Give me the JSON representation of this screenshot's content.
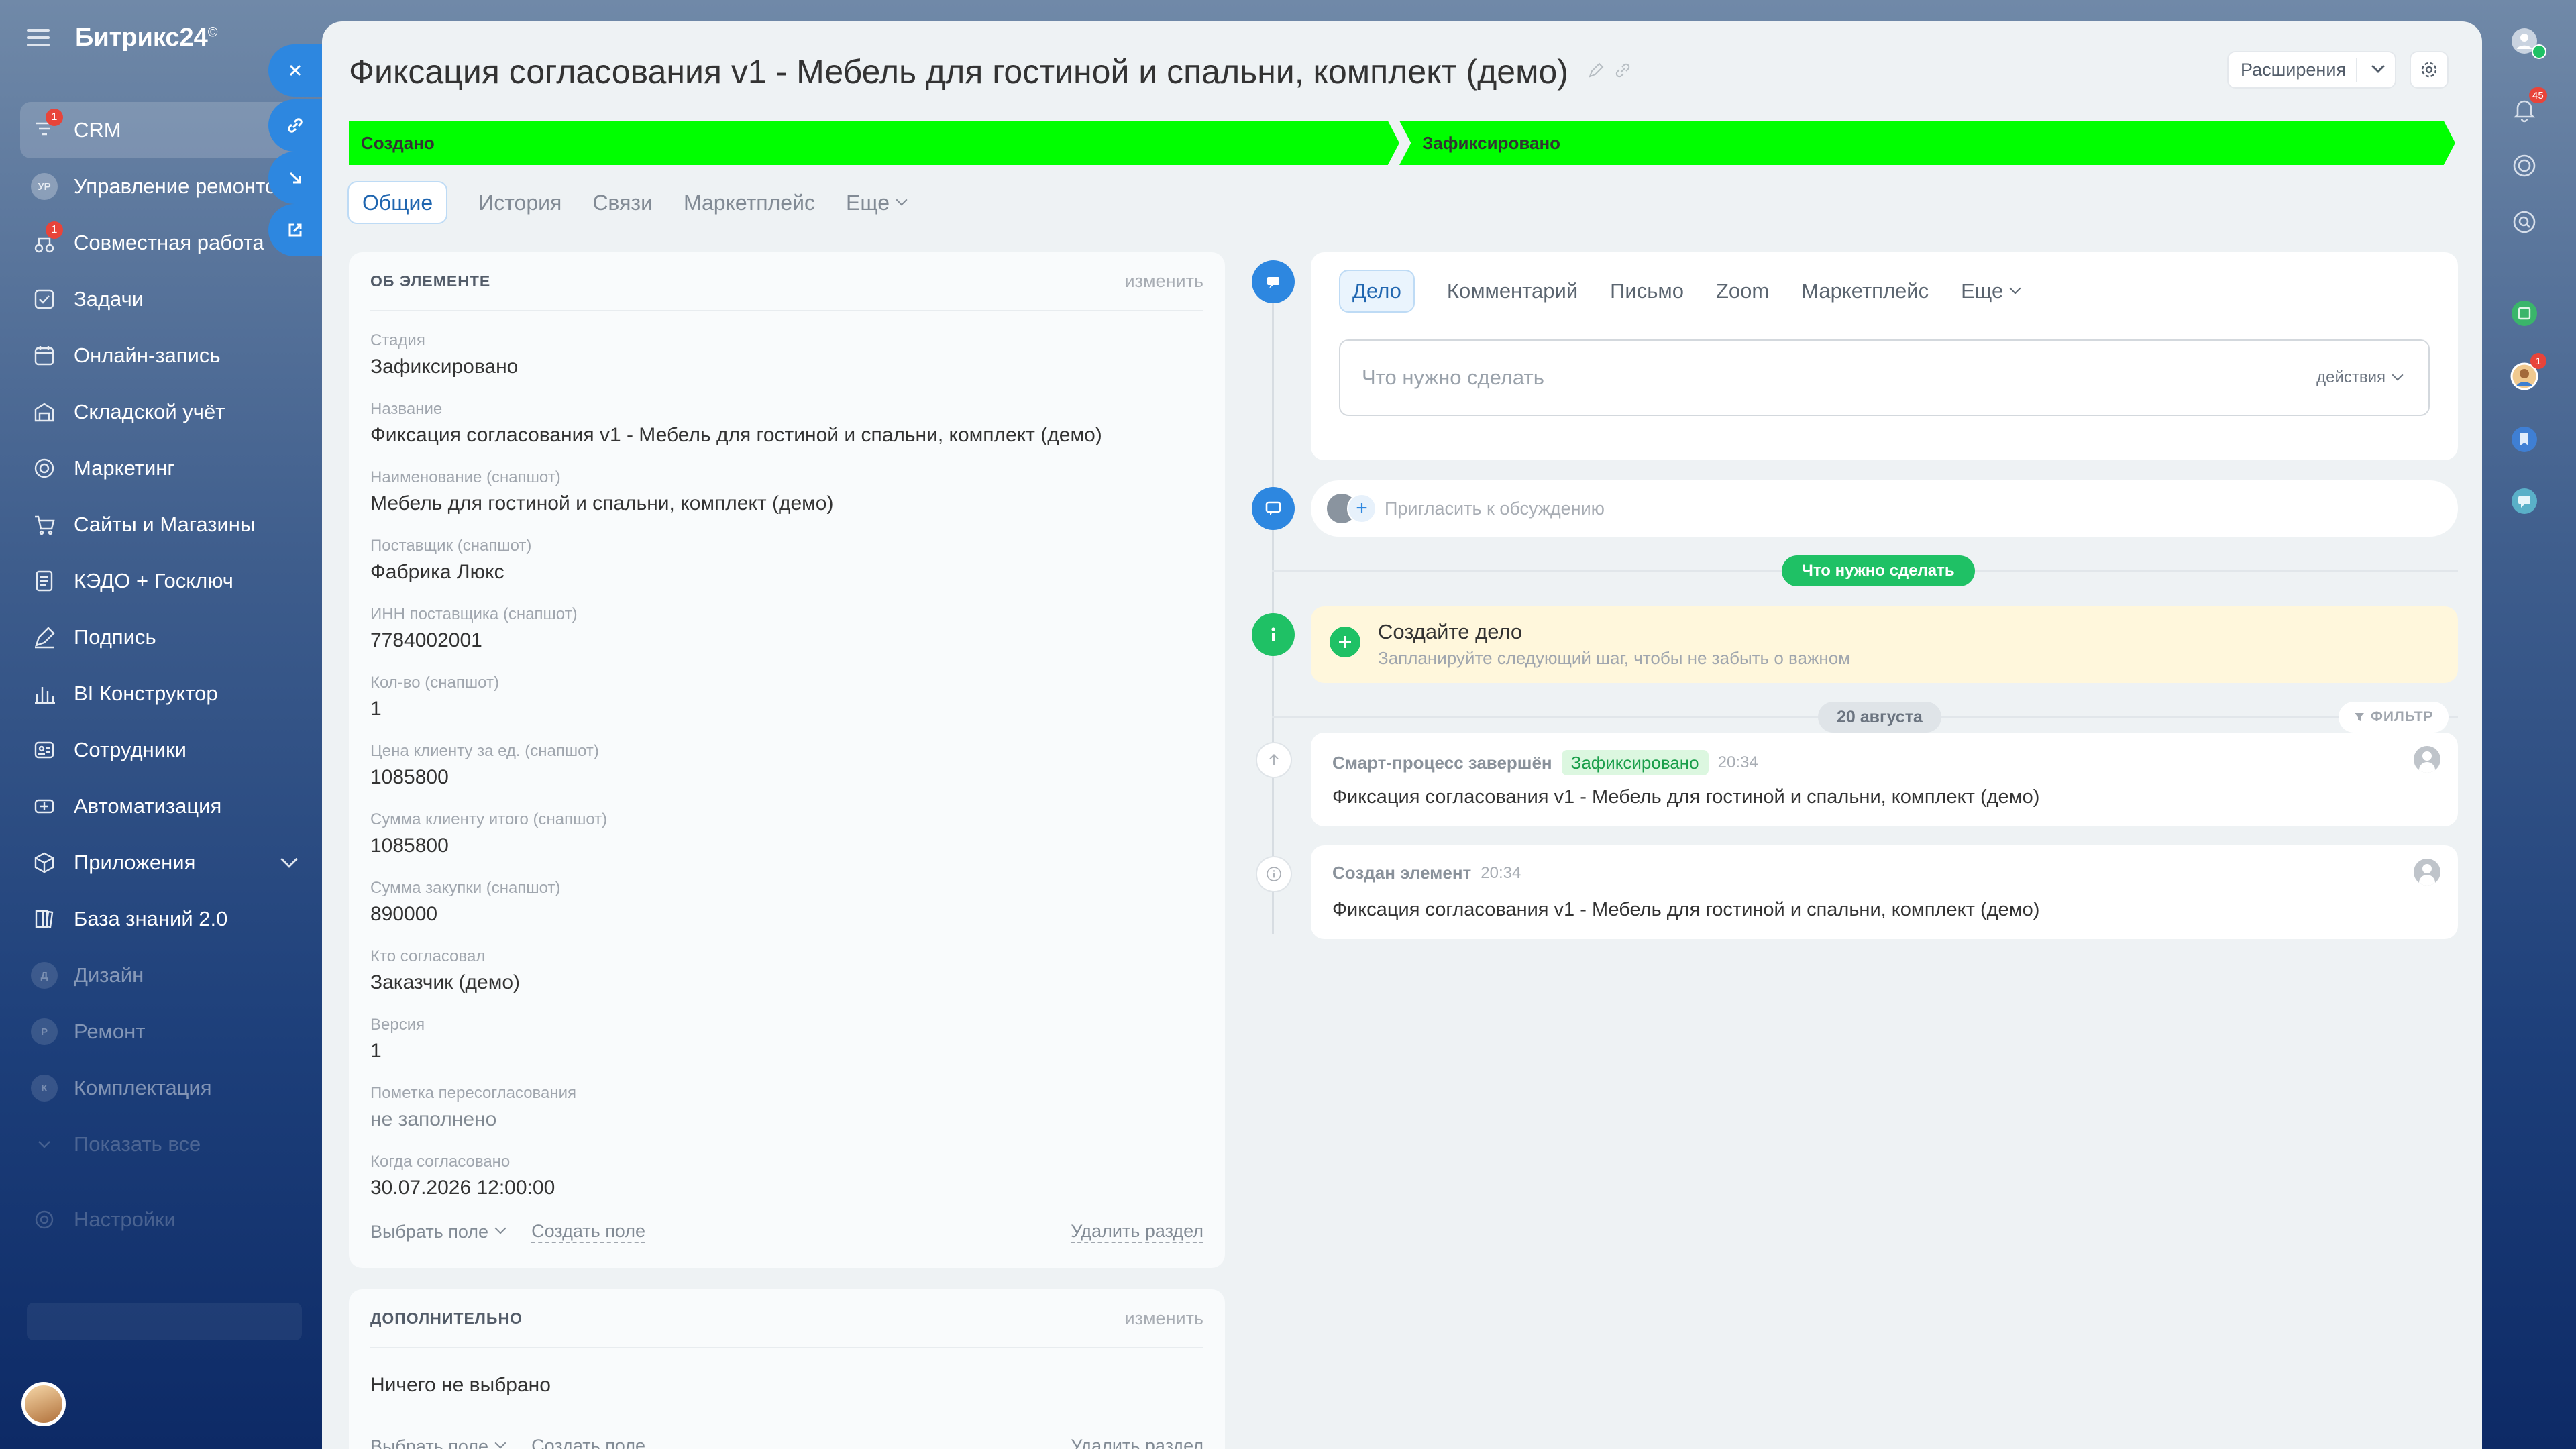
{
  "app": {
    "logo": "Битрикс24",
    "logo_mark": "©"
  },
  "sidebar": {
    "items": [
      {
        "label": "CRM",
        "badge": "1"
      },
      {
        "label": "Управление ремонто...",
        "initials": "УР"
      },
      {
        "label": "Совместная работа",
        "badge": "1"
      },
      {
        "label": "Задачи"
      },
      {
        "label": "Онлайн-запись"
      },
      {
        "label": "Складской учёт"
      },
      {
        "label": "Маркетинг"
      },
      {
        "label": "Сайты и Магазины"
      },
      {
        "label": "КЭДО + Госключ"
      },
      {
        "label": "Подпись"
      },
      {
        "label": "BI Конструктор"
      },
      {
        "label": "Сотрудники"
      },
      {
        "label": "Автоматизация"
      },
      {
        "label": "Приложения"
      },
      {
        "label": "База знаний 2.0"
      },
      {
        "label": "Дизайн",
        "initials": "Д"
      },
      {
        "label": "Ремонт",
        "initials": "Р"
      },
      {
        "label": "Комплектация",
        "initials": "К"
      },
      {
        "label": "Показать все"
      },
      {
        "label": "Настройки"
      }
    ]
  },
  "header": {
    "title": "Фиксация согласования v1 - Мебель для гостиной и спальни, комплект (демо)",
    "extensions_label": "Расширения"
  },
  "stages": [
    {
      "label": "Создано",
      "color": "#00ff00"
    },
    {
      "label": "Зафиксировано",
      "color": "#00ff00"
    }
  ],
  "tabs": [
    "Общие",
    "История",
    "Связи",
    "Маркетплейс",
    "Еще"
  ],
  "about": {
    "heading": "ОБ ЭЛЕМЕНТЕ",
    "edit": "изменить",
    "fields": [
      {
        "label": "Стадия",
        "value": "Зафиксировано"
      },
      {
        "label": "Название",
        "value": "Фиксация согласования v1 - Мебель для гостиной и спальни, комплект (демо)"
      },
      {
        "label": "Наименование (снапшот)",
        "value": "Мебель для гостиной и спальни, комплект (демо)"
      },
      {
        "label": "Поставщик (снапшот)",
        "value": "Фабрика Люкс"
      },
      {
        "label": "ИНН поставщика (снапшот)",
        "value": "7784002001"
      },
      {
        "label": "Кол-во (снапшот)",
        "value": "1"
      },
      {
        "label": "Цена клиенту за ед. (снапшот)",
        "value": "1085800"
      },
      {
        "label": "Сумма клиенту итого (снапшот)",
        "value": "1085800"
      },
      {
        "label": "Сумма закупки (снапшот)",
        "value": "890000"
      },
      {
        "label": "Кто согласовал",
        "value": "Заказчик (демо)"
      },
      {
        "label": "Версия",
        "value": "1"
      },
      {
        "label": "Пометка пересогласования",
        "value": "не заполнено"
      },
      {
        "label": "Когда согласовано",
        "value": "30.07.2026 12:00:00"
      }
    ],
    "select_field": "Выбрать поле",
    "create_field": "Создать поле",
    "delete_section": "Удалить раздел"
  },
  "additional": {
    "heading": "ДОПОЛНИТЕЛЬНО",
    "edit": "изменить",
    "empty": "Ничего не выбрано",
    "select_field": "Выбрать поле",
    "create_field": "Создать поле",
    "delete_section": "Удалить раздел"
  },
  "editor": {
    "tabs": [
      "Дело",
      "Комментарий",
      "Письмо",
      "Zoom",
      "Маркетплейс",
      "Еще"
    ],
    "placeholder": "Что нужно сделать",
    "actions": "действия"
  },
  "invite": {
    "placeholder": "Пригласить к обсуждению"
  },
  "todo_pill": "Что нужно сделать",
  "todo": {
    "title": "Создайте дело",
    "subtitle": "Запланируйте следующий шаг, чтобы не забыть о важном"
  },
  "date_pill": "20 августа",
  "filter_label": "ФИЛЬТР",
  "history": [
    {
      "title": "Смарт-процесс завершён",
      "badge": "Зафиксировано",
      "time": "20:34",
      "text": "Фиксация согласования v1 - Мебель для гостиной и спальни, комплект (демо)"
    },
    {
      "title": "Создан элемент",
      "time": "20:34",
      "text": "Фиксация согласования v1 - Мебель для гостиной и спальни, комплект (демо)"
    }
  ],
  "rail": {
    "notifications_badge": "45",
    "avatar_badge": "1"
  }
}
